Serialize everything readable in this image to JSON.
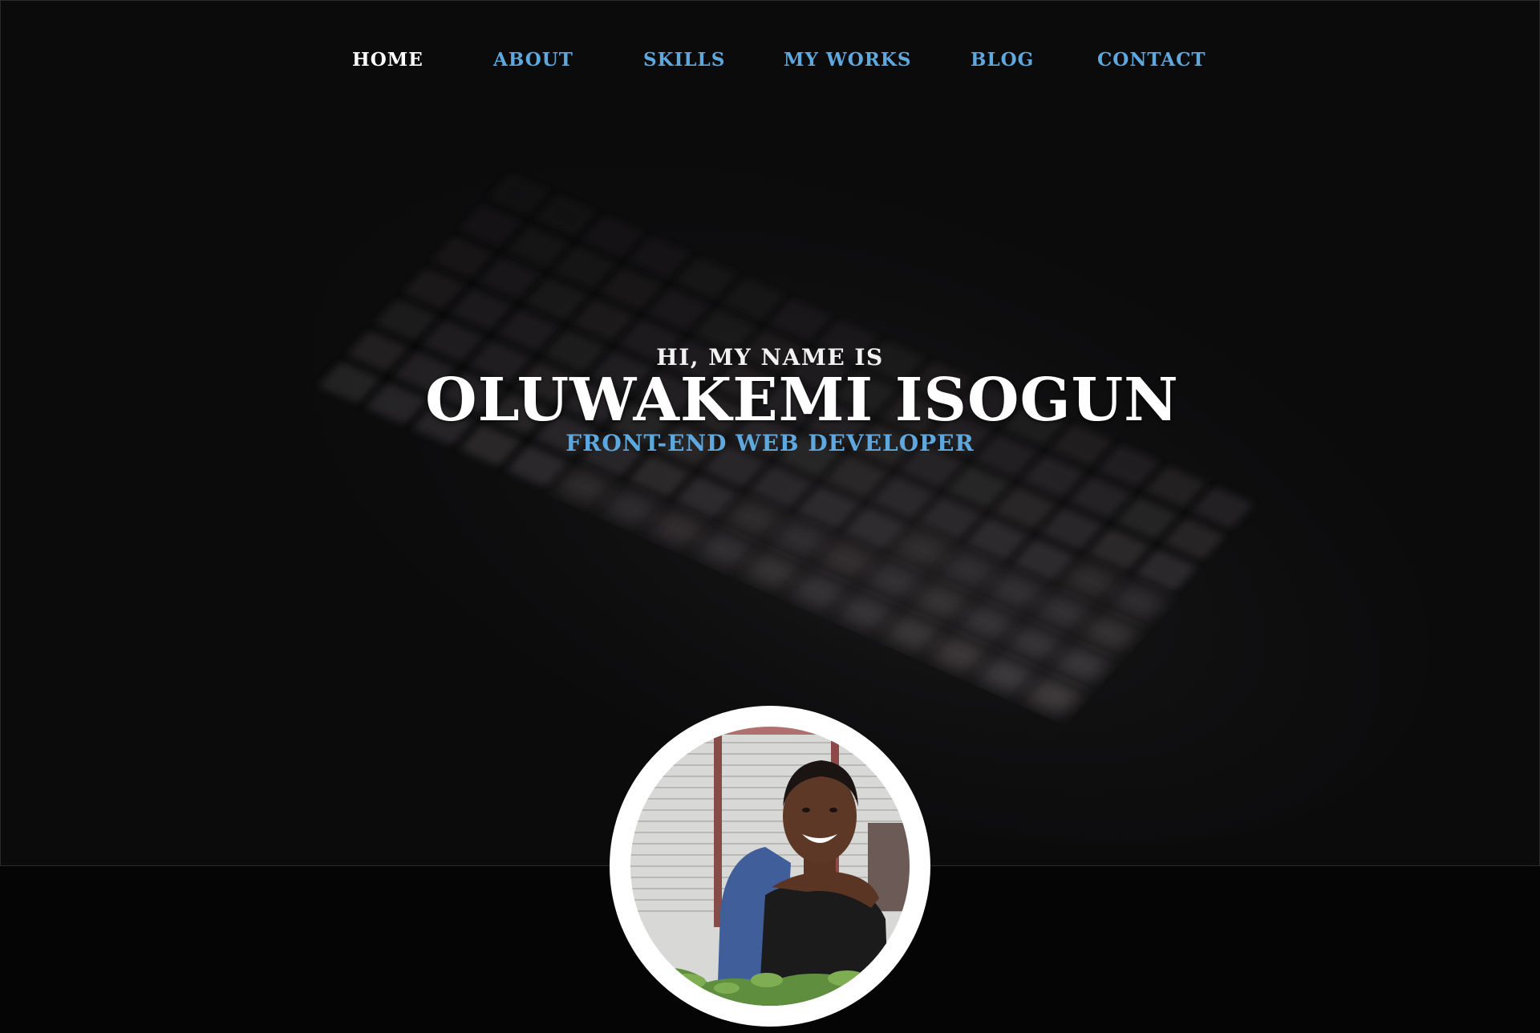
{
  "nav": {
    "items": [
      {
        "label": "HOME",
        "active": true
      },
      {
        "label": "ABOUT",
        "active": false
      },
      {
        "label": "SKILLS",
        "active": false
      },
      {
        "label": "MY WORKS",
        "active": false
      },
      {
        "label": "BLOG",
        "active": false
      },
      {
        "label": "CONTACT",
        "active": false
      }
    ]
  },
  "hero": {
    "greeting": "HI, MY NAME IS",
    "name": "OLUWAKEMI ISOGUN",
    "role": "FRONT-END WEB DEVELOPER",
    "background_image": "blurred-backlit-keyboard"
  },
  "profile": {
    "image": "profile-photo"
  },
  "colors": {
    "accent": "#5fa8dd",
    "active_nav": "#ffffff",
    "hero_bg": "#0b0b0c",
    "page_bg": "#050505"
  }
}
